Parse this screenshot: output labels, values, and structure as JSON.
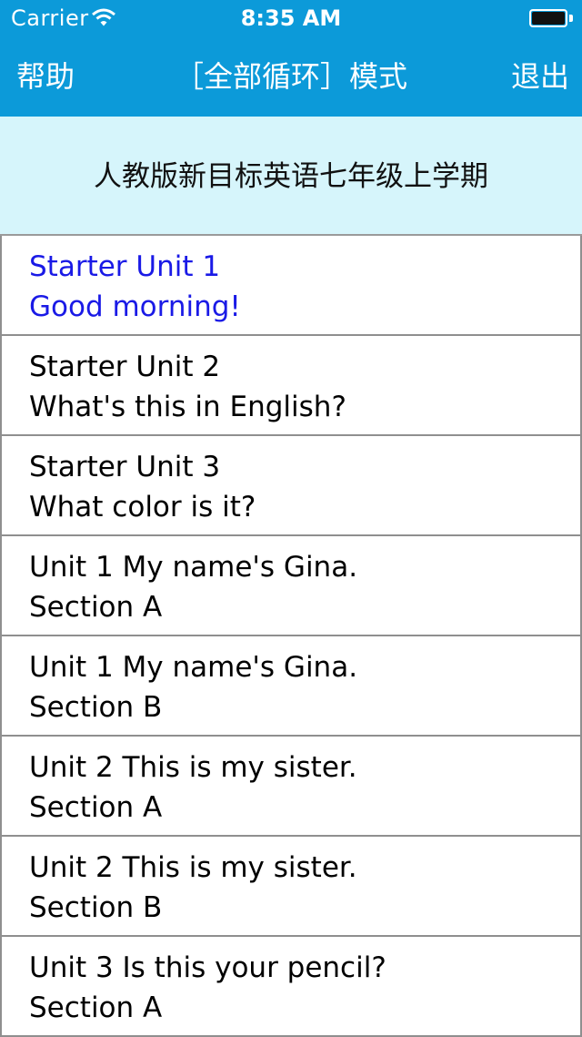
{
  "status_bar": {
    "carrier": "Carrier",
    "time": "8:35 AM"
  },
  "nav": {
    "left": "帮助",
    "title": "［全部循环］模式",
    "right": "退出"
  },
  "header": {
    "title": "人教版新目标英语七年级上学期"
  },
  "colors": {
    "nav_bg": "#0c9ad9",
    "header_bg": "#d6f5fb",
    "active_text": "#1a1ae6"
  },
  "list": [
    {
      "line1": "Starter Unit 1",
      "line2": "Good morning!",
      "active": true
    },
    {
      "line1": "Starter Unit 2",
      "line2": "What's this in English?",
      "active": false
    },
    {
      "line1": "Starter Unit 3",
      "line2": "What color is it?",
      "active": false
    },
    {
      "line1": "Unit 1 My name's Gina.",
      "line2": "Section A",
      "active": false
    },
    {
      "line1": "Unit 1 My name's Gina.",
      "line2": "Section B",
      "active": false
    },
    {
      "line1": "Unit 2 This is my sister.",
      "line2": "Section A",
      "active": false
    },
    {
      "line1": "Unit 2 This is my sister.",
      "line2": "Section B",
      "active": false
    },
    {
      "line1": "Unit 3 Is this your pencil?",
      "line2": "Section A",
      "active": false
    }
  ]
}
